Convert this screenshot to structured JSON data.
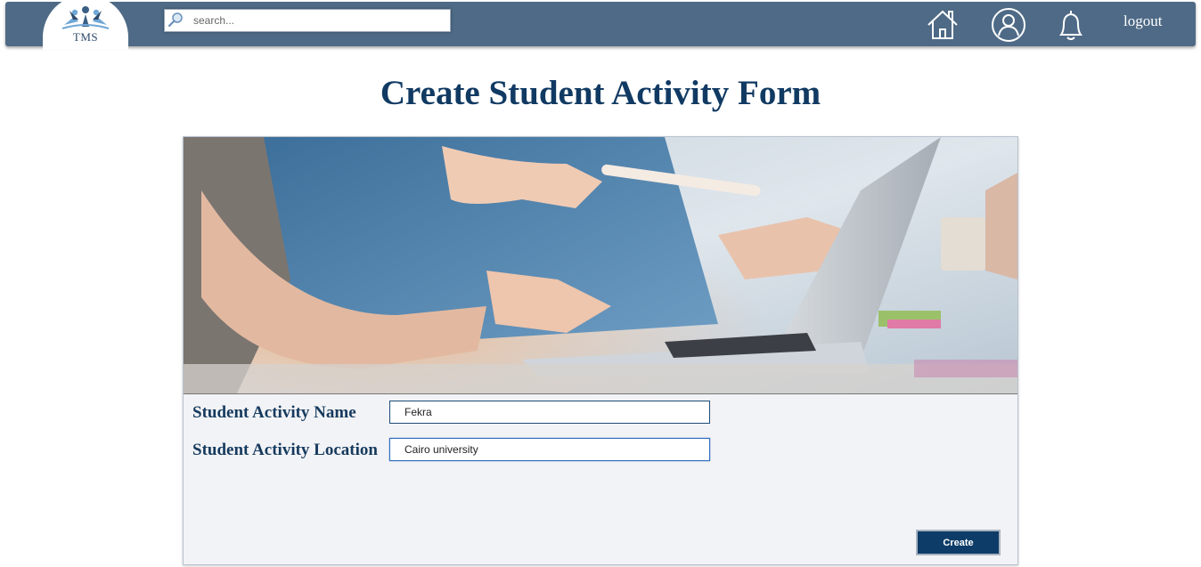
{
  "header": {
    "logo_text": "TMS",
    "search_placeholder": "search...",
    "nav": {
      "home_icon": "home-icon",
      "profile_icon": "user-icon",
      "notifications_icon": "bell-icon",
      "logout_label": "logout"
    }
  },
  "page": {
    "title": "Create Student Activity Form"
  },
  "form": {
    "hero_image": "team-working-at-laptop-photo",
    "fields": [
      {
        "label": "Student Activity Name",
        "value": "Fekra"
      },
      {
        "label": "Student Activity Location",
        "value": "Cairo university"
      }
    ],
    "submit_label": "Create"
  },
  "colors": {
    "topbar": "#4e6a86",
    "title": "#113a63",
    "button": "#0e3c68",
    "card_bg": "#f2f3f6"
  }
}
